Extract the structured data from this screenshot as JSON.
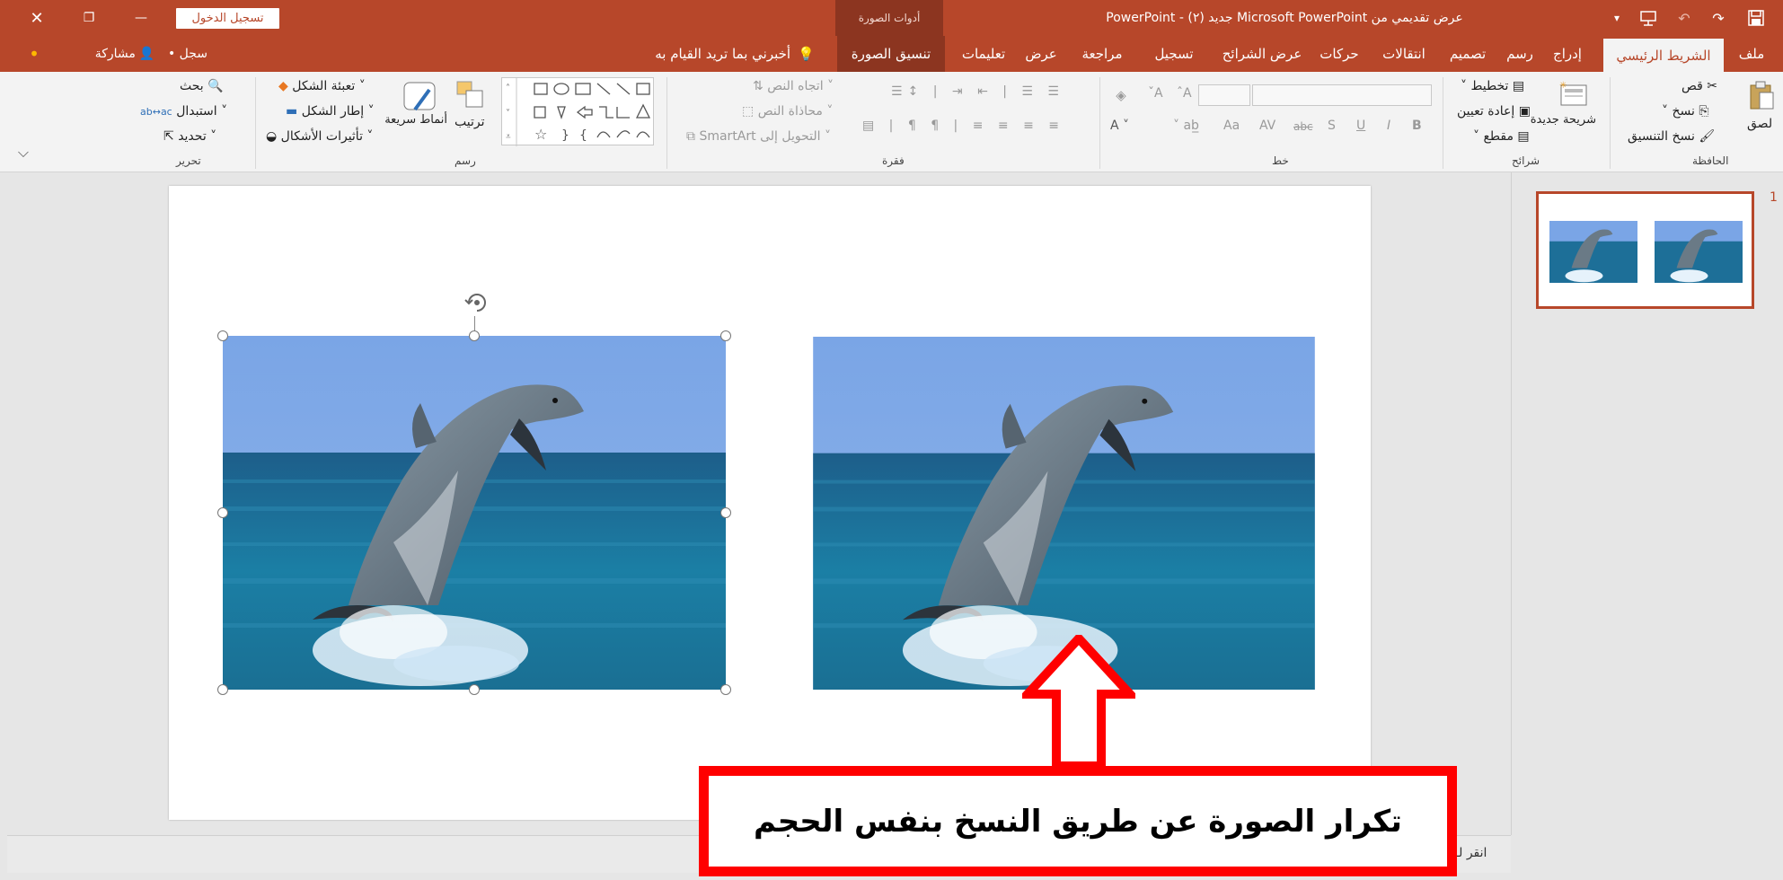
{
  "titlebar": {
    "login_label": "تسجيل الدخول",
    "tools_label": "أدوات الصورة",
    "doc_title": "عرض تقديمي من Microsoft PowerPoint جديد (٢) - PowerPoint",
    "close_icon": "✕",
    "restore_icon": "❐",
    "minimize_icon": "—",
    "save_icon": "💾",
    "redo_icon": "↷",
    "undo_icon": "↶",
    "customize_icon": "▾"
  },
  "tabs": [
    {
      "label": "ملف"
    },
    {
      "label": "الشريط الرئيسي"
    },
    {
      "label": "إدراج"
    },
    {
      "label": "رسم"
    },
    {
      "label": "تصميم"
    },
    {
      "label": "انتقالات"
    },
    {
      "label": "حركات"
    },
    {
      "label": "عرض الشرائح"
    },
    {
      "label": "تسجيل"
    },
    {
      "label": "مراجعة"
    },
    {
      "label": "عرض"
    },
    {
      "label": "تعليمات"
    },
    {
      "label": "تنسيق الصورة"
    }
  ],
  "tell_me": "أخبرني بما تريد القيام به",
  "record_label": "• سجل",
  "share_label": "مشاركة",
  "ribbon": {
    "clipboard": {
      "paste": "لصق",
      "cut": "قص",
      "copy": "نسخ",
      "format_painter": "نسخ التنسيق",
      "group_label": "الحافظة"
    },
    "slides": {
      "new_slide": "شريحة جديدة",
      "layout": "تخطيط",
      "reset": "إعادة تعيين",
      "section": "مقطع",
      "group_label": "شرائح"
    },
    "font": {
      "group_label": "خط",
      "bold": "B",
      "italic": "I",
      "underline": "U",
      "shadow": "S",
      "strike": "abc",
      "spacing": "AV",
      "case": "Aa",
      "grow": "Aˆ",
      "shrink": "Aˇ"
    },
    "paragraph": {
      "text_direction": "اتجاه النص",
      "align_text": "محاذاة النص",
      "smartart": "التحويل إلى SmartArt",
      "group_label": "فقرة"
    },
    "drawing": {
      "arrange": "ترتيب",
      "quick_styles": "أنماط سريعة",
      "shape_fill": "تعبئة الشكل",
      "shape_outline": "إطار الشكل",
      "shape_effects": "تأثيرات الأشكال",
      "group_label": "رسم"
    },
    "editing": {
      "find": "بحث",
      "replace": "استبدال",
      "select": "تحديد",
      "group_label": "تحرير"
    }
  },
  "thumbnail": {
    "number": "1"
  },
  "notes_hint": "انقر لـ",
  "callout_text": "تكرار الصورة عن طريق النسخ بنفس الحجم",
  "colors": {
    "accent": "#b7472a",
    "callout_red": "#ff0000"
  }
}
